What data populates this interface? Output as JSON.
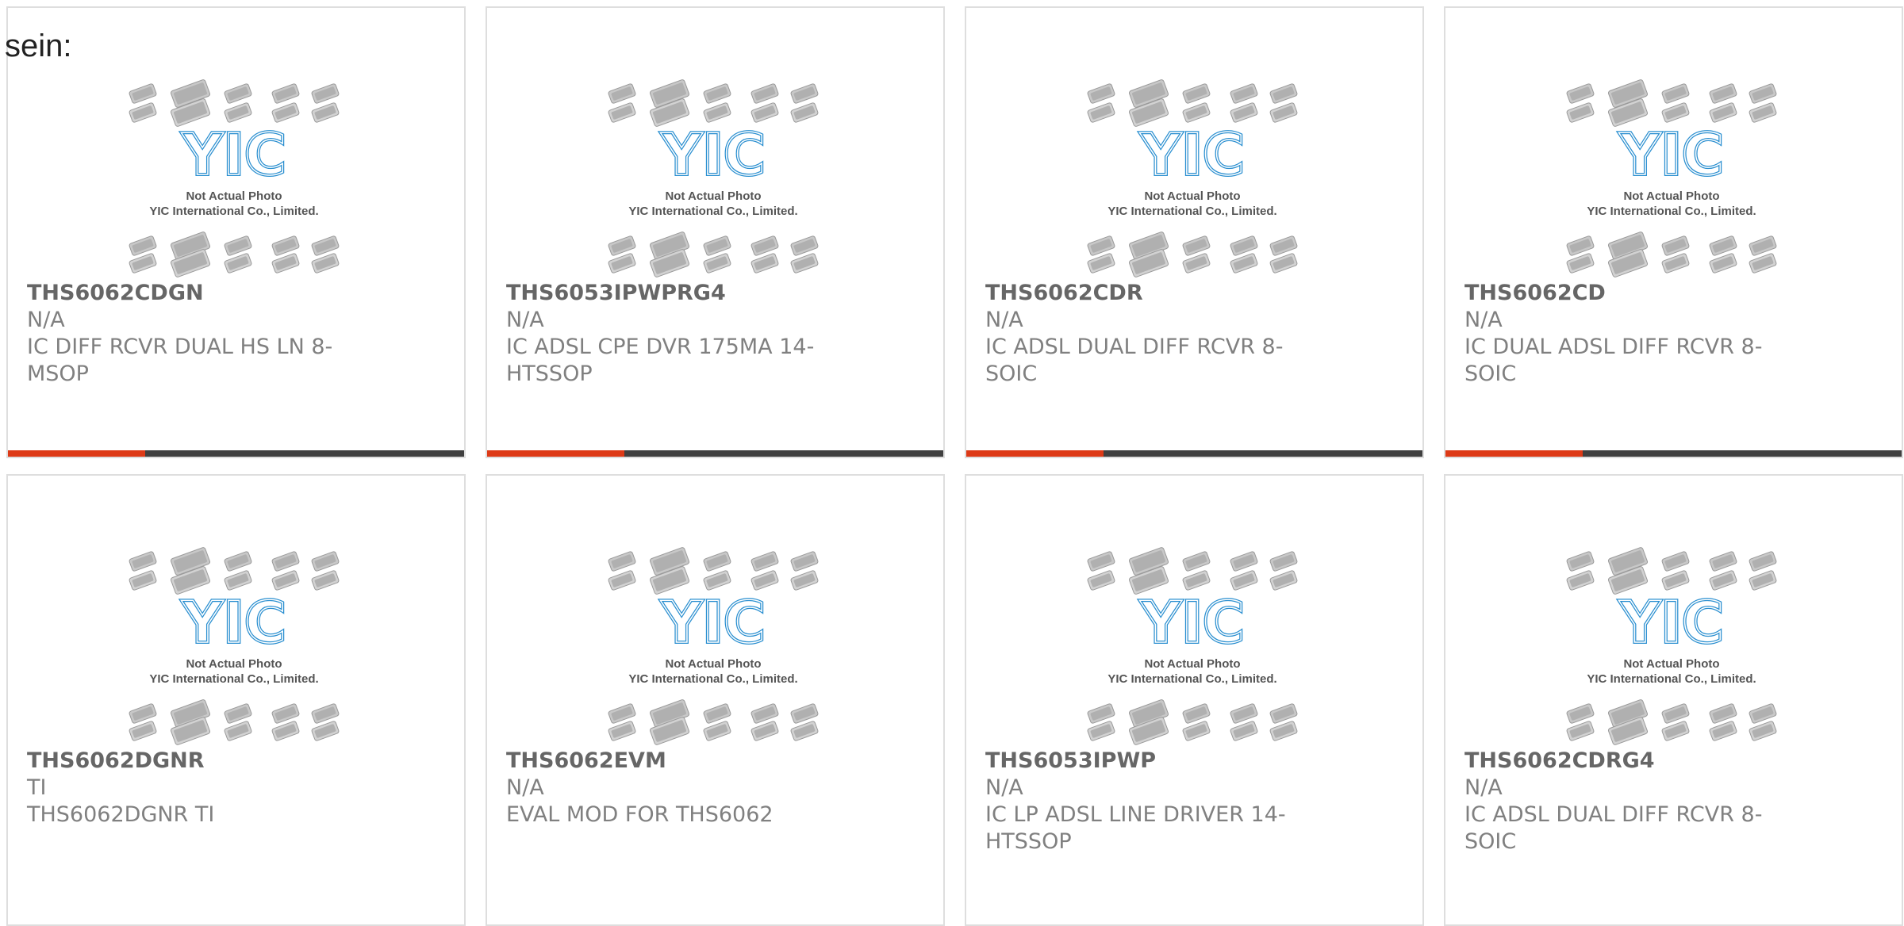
{
  "intro_text": "sein:",
  "placeholder_image": {
    "line1": "Not Actual Photo",
    "line2": "YIC International Co., Limited.",
    "logo_text": "YIC"
  },
  "colors": {
    "accent_orange": "#dd3a17",
    "accent_dark": "#404040",
    "logo_blue": "#2a8fd0",
    "part_number": "#666666",
    "text_gray": "#808080"
  },
  "accent_fill_fraction": 0.3,
  "products": [
    {
      "part_number": "THS6062CDGN",
      "manufacturer": "N/A",
      "description": "IC DIFF RCVR DUAL HS LN 8-MSOP"
    },
    {
      "part_number": "THS6053IPWPRG4",
      "manufacturer": "N/A",
      "description": "IC ADSL CPE DVR 175MA 14-HTSSOP"
    },
    {
      "part_number": "THS6062CDR",
      "manufacturer": "N/A",
      "description": "IC ADSL DUAL DIFF RCVR 8-SOIC"
    },
    {
      "part_number": "THS6062CD",
      "manufacturer": "N/A",
      "description": "IC DUAL ADSL DIFF RCVR 8-SOIC"
    },
    {
      "part_number": "THS6062DGNR",
      "manufacturer": "TI",
      "description": "THS6062DGNR TI"
    },
    {
      "part_number": "THS6062EVM",
      "manufacturer": "N/A",
      "description": "EVAL MOD FOR THS6062"
    },
    {
      "part_number": "THS6053IPWP",
      "manufacturer": "N/A",
      "description": "IC LP ADSL LINE DRIVER 14-HTSSOP"
    },
    {
      "part_number": "THS6062CDRG4",
      "manufacturer": "N/A",
      "description": "IC ADSL DUAL DIFF RCVR 8-SOIC"
    }
  ]
}
